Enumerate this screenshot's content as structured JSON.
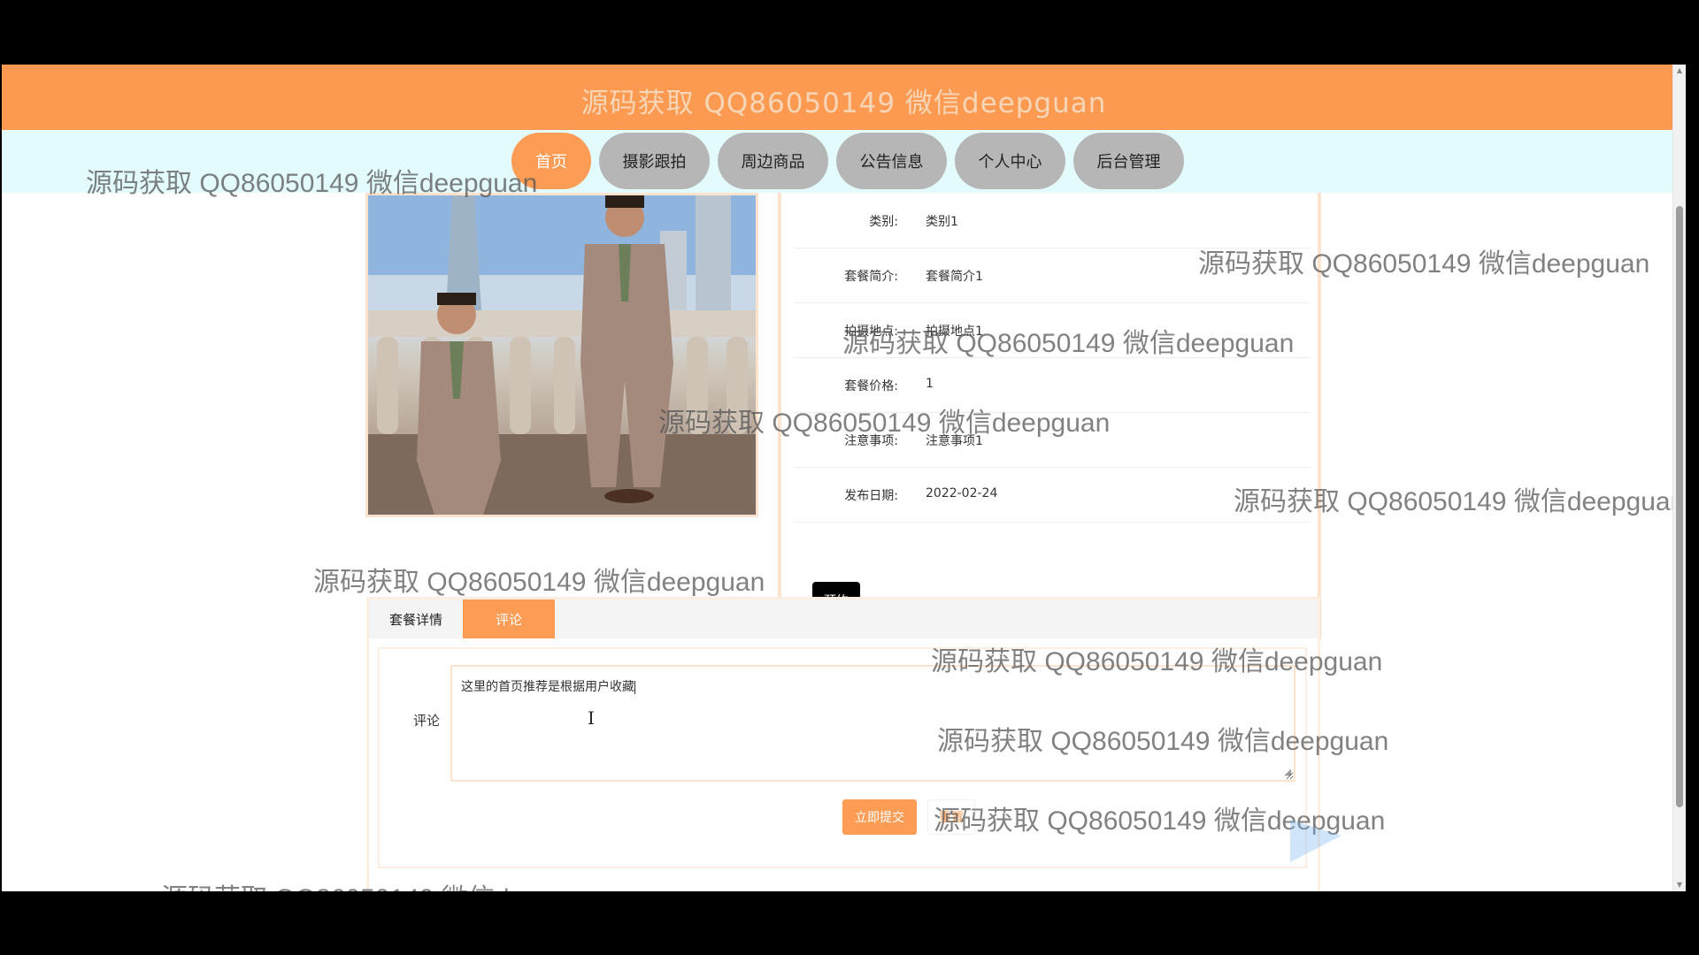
{
  "header": {
    "title": "源码获取 QQ86050149 微信deepguan"
  },
  "nav": {
    "items": [
      {
        "label": "首页",
        "active": true
      },
      {
        "label": "摄影跟拍",
        "active": false
      },
      {
        "label": "周边商品",
        "active": false
      },
      {
        "label": "公告信息",
        "active": false
      },
      {
        "label": "个人中心",
        "active": false
      },
      {
        "label": "后台管理",
        "active": false
      }
    ]
  },
  "details": {
    "rows": [
      {
        "label": "类别:",
        "value": "类别1"
      },
      {
        "label": "套餐简介:",
        "value": "套餐简介1"
      },
      {
        "label": "拍摄地点:",
        "value": "拍摄地点1"
      },
      {
        "label": "套餐价格:",
        "value": "1"
      },
      {
        "label": "注意事项:",
        "value": "注意事项1"
      },
      {
        "label": "发布日期:",
        "value": "2022-02-24"
      }
    ],
    "book_button": "预约"
  },
  "tabs": {
    "items": [
      "套餐详情",
      "评论"
    ],
    "active": "评论"
  },
  "comment": {
    "label": "评论",
    "text": "这里的首页推荐是根据用户收藏",
    "submit_button": "立即提交",
    "reset_button": "重置"
  },
  "watermark": {
    "text": "源码获取 QQ86050149 微信deepguan"
  },
  "colors": {
    "accent": "#fd9c55",
    "header_bg": "#fc9a52",
    "nav_bg": "#e4fbfd",
    "nav_inactive": "#b6b6b6"
  }
}
